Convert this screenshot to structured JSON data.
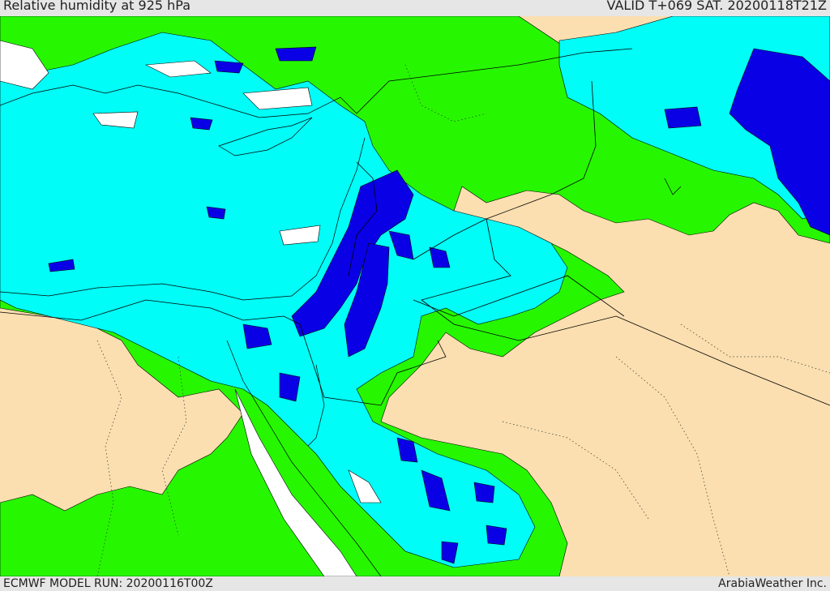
{
  "header": {
    "title": "Relative humidity at 925 hPa",
    "valid": "VALID T+069 SAT. 20200118T21Z"
  },
  "footer": {
    "model_run": "ECMWF MODEL RUN: 20200116T00Z",
    "credit": "ArabiaWeather Inc."
  },
  "colors": {
    "land_dry": "#fbdfb0",
    "humid_green": "#26f700",
    "humid_cyan": "#00fdf7",
    "humid_blue": "#0a00e6",
    "sea_white": "#ffffff",
    "border_line": "#000000"
  }
}
